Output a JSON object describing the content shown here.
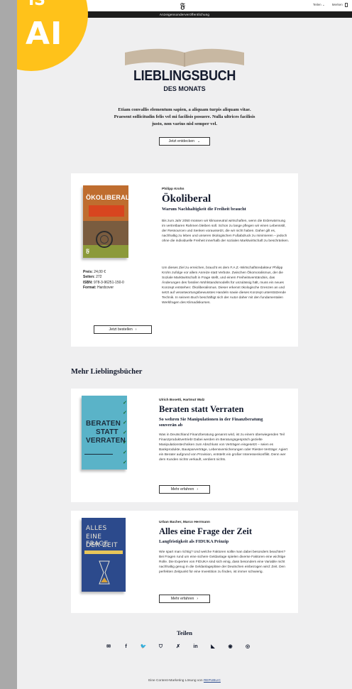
{
  "badge": {
    "label": "AI",
    "top_fragment": "IS"
  },
  "header": {
    "logo": "𝔉",
    "menu_teilen": "Teilen",
    "menu_teilen_chevron": "⌄",
    "menu_merken": "Merken",
    "banner": "Anzeigensonderveröffentlichung"
  },
  "hero": {
    "title": "LIEBLINGSBUCH",
    "subtitle": "DES MONATS",
    "intro": "Etiam convallis elementum sapien, a aliquam turpis aliquam vitae. Praesent sollicitudin felis vel mi facilisis posuere. Nulla ultrices facilisis justo, non varius nisl semper vel.",
    "discover_label": "Jetzt entdecken",
    "discover_chevron": "⌄"
  },
  "featured": {
    "author": "Philipp Krohn",
    "title": "Ökoliberal",
    "subtitle": "Warum Nachhaltigkeit die Freiheit braucht",
    "paragraph1": "Bis zum Jahr 2050 müssen wir klimaneutral wirtschaften, wenn die Erderwärmung im vertretbaren Rahmen bleiben soll. Schon zu lange pflegen wir einen Lebensstil, der Ressourcen und Senken voraussetzt, die wir nicht haben. Daher gilt es, nachhaltig zu leben und unseren ökologischen Fußabdruck zu minimieren – jedoch ohne die individuelle Freiheit innerhalb der sozialen Marktwirtschaft zu beschränken.",
    "paragraph2": "Um dieses Ziel zu erreichen, braucht es dem F.A.Z.-Wirtschaftsredakteur Philipp Krohn zufolge vor allem Anreize statt Verbote. Zwischen Ökomoralismus, der die Soziale Marktwirtschaft in Frage stellt, und einem Freiheitsverständnis, das Änderungen des fossilen Wohlstandsmodells für unzulässig hält, muss ein neues Konzept entstehen: Ökoliberalismus. Dieser erkennt ökologische Grenzen an und setzt auf verantwortungsbewusstes Handeln sowie dieses Konzept unterstützende Technik. In seinem Buch beschäftigt sich der Autor daher mit den fundamentalen Werkfragen des Klimadiskurses.",
    "specs": {
      "price_label": "Preis:",
      "price": "24,00 €",
      "pages_label": "Seiten:",
      "pages": "272",
      "isbn_label": "ISBN:",
      "isbn": "978-3-96251-150-0",
      "format_label": "Format:",
      "format": "Hardcover"
    },
    "order_label": "Jetzt bestellen",
    "order_chevron": "›",
    "cover": {
      "top_text": "Philipp Krohn",
      "title": "ÖKOLIBERAL",
      "strip": "Warum Nachhaltigkeit die Freiheit braucht",
      "logo": "𝔉"
    }
  },
  "more": {
    "heading": "Mehr Lieblingsbücher",
    "books": [
      {
        "author": "Ulrich Bosetti, Hartmut Walz",
        "title": "Beraten statt Verraten",
        "subtitle": "So wehren Sie Manipulationen in der Finanzberatung souverän ab",
        "description": "Was in Deutschland Finanzberatung genannt wird, ist zu einem überwiegenden Teil Finanzproduktvertrieb! Dabei werden im Beratungsgespräch gezielte Manipulationstechniken zum Abschluss von Verträgen eingesetzt – seien es Bankprodukte, Bausparverträge, Lebensversicherungen oder Riester-Verträge: Agiert ein Berater aufgrund von Provision, entsteht ein großer Interessenkonflikt. Denn wer dem Kunden nichts verkauft, verdient nichts.",
        "button_label": "Mehr erfahren",
        "button_chevron": "›",
        "cover_lines": [
          "BERATEN",
          "STATT",
          "VERRATEN"
        ],
        "cover_mark": "✓"
      },
      {
        "author": "Urban Bacher, Marco Herrmann",
        "title": "Alles eine Frage der Zeit",
        "subtitle": "Langfristigkeit als FIDUKA Prinzip",
        "description": "Wie spart man richtig? Und welche Faktoren sollte man dabei besonders beachten? Bei Fragen rund um eine sichere Geldanlage spielen diverse Faktoren eine wichtige Rolle. Die Experten von FIDUKA sind sich einig, dass besonders eine Variable nicht nachhaltig genug in die Geldanlagepläne der Deutschen einbezogen wird: Zeit. Den perfekten Zeitpunkt für eine Investition zu finden, ist immer schwierig.",
        "button_label": "Mehr erfahren",
        "button_chevron": "›",
        "cover_lines": [
          "ALLES",
          "EINE FRAGE",
          "DER ZEIT"
        ]
      }
    ]
  },
  "share": {
    "heading": "Teilen",
    "icons": [
      {
        "name": "mail-icon",
        "glyph": "✉"
      },
      {
        "name": "facebook-icon",
        "glyph": "f"
      },
      {
        "name": "twitter-icon",
        "glyph": "🐦"
      },
      {
        "name": "pocket-icon",
        "glyph": "⛉"
      },
      {
        "name": "xing-icon",
        "glyph": "✗"
      },
      {
        "name": "linkedin-icon",
        "glyph": "in"
      },
      {
        "name": "flipboard-icon",
        "glyph": "◣"
      },
      {
        "name": "messenger-icon",
        "glyph": "◉"
      },
      {
        "name": "whatsapp-icon",
        "glyph": "◎"
      }
    ]
  },
  "footer": {
    "text": "Eine Content-Marketing Lösung von",
    "brand": "REPUBLIC"
  }
}
